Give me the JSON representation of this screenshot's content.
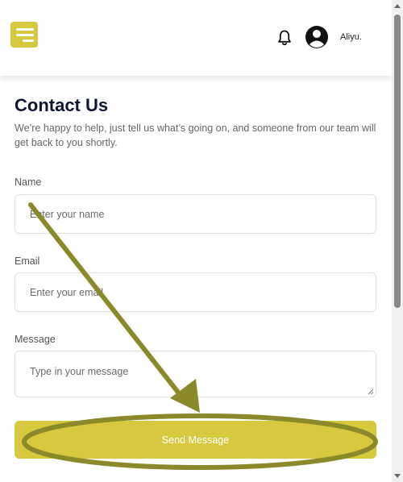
{
  "header": {
    "user_name": "Aliyu."
  },
  "page": {
    "title": "Contact Us",
    "intro": "We’re happy to help, just tell us what’s going on, and someone from our team will get back to you shortly."
  },
  "form": {
    "name_label": "Name",
    "name_placeholder": "Enter your name",
    "email_label": "Email",
    "email_placeholder": "Enter your email",
    "message_label": "Message",
    "message_placeholder": "Type in your message",
    "submit_label": "Send Message"
  },
  "colors": {
    "accent": "#d8c840",
    "annotation": "#8a8a2a",
    "title": "#0f1733"
  },
  "icons": [
    "menu-icon",
    "bell-icon",
    "user-avatar-icon"
  ]
}
